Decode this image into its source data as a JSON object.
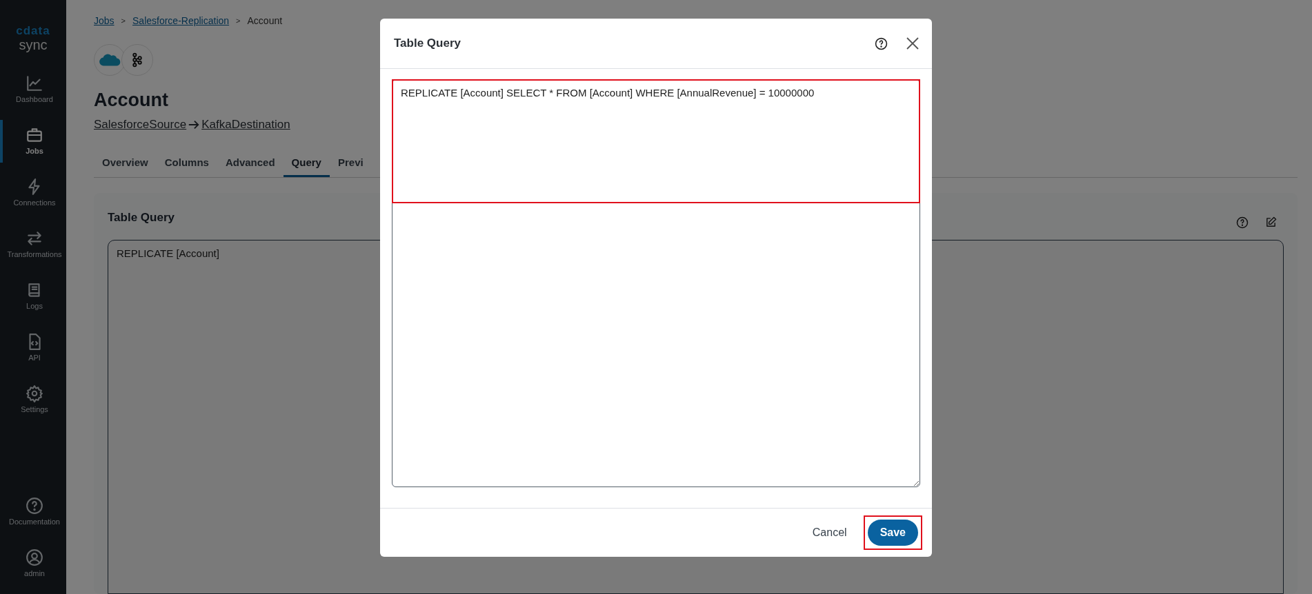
{
  "sidebar": {
    "logo": {
      "brand": "cdata",
      "product": "sync"
    },
    "items": [
      {
        "label": "Dashboard",
        "selected": false
      },
      {
        "label": "Jobs",
        "selected": true
      },
      {
        "label": "Connections",
        "selected": false
      },
      {
        "label": "Transformations",
        "selected": false
      },
      {
        "label": "Logs",
        "selected": false
      },
      {
        "label": "API",
        "selected": false
      },
      {
        "label": "Settings",
        "selected": false
      }
    ],
    "bottom_items": [
      {
        "label": "Documentation",
        "selected": false
      },
      {
        "label": "admin",
        "selected": false
      }
    ]
  },
  "breadcrumbs": {
    "separator": ">",
    "items": [
      {
        "label": "Jobs",
        "link": true
      },
      {
        "label": "Salesforce-Replication",
        "link": true
      },
      {
        "label": "Account",
        "link": false
      }
    ]
  },
  "page": {
    "title": "Account",
    "source": "SalesforceSource",
    "destination": "KafkaDestination"
  },
  "tabs": [
    {
      "label": "Overview",
      "selected": false
    },
    {
      "label": "Columns",
      "selected": false
    },
    {
      "label": "Advanced",
      "selected": false
    },
    {
      "label": "Query",
      "selected": true
    },
    {
      "label": "Previ",
      "selected": false
    }
  ],
  "card": {
    "title": "Table Query",
    "query": "REPLICATE [Account]"
  },
  "modal": {
    "title": "Table Query",
    "query": "REPLICATE [Account] SELECT * FROM [Account] WHERE [AnnualRevenue] = 10000000",
    "query_highlighted": true,
    "buttons": [
      {
        "label": "Cancel",
        "kind": "text",
        "highlighted": false
      },
      {
        "label": "Save",
        "kind": "primary",
        "highlighted": true
      }
    ]
  }
}
